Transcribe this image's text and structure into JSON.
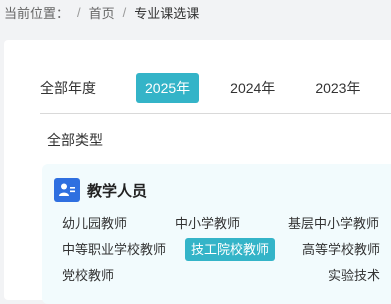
{
  "breadcrumb": {
    "prefix": "当前位置：",
    "sep1": "/",
    "home": "首页",
    "sep2": "/",
    "current": "专业课选课"
  },
  "year_filter": {
    "label": "全部年度",
    "items": [
      "2025年",
      "2024年",
      "2023年"
    ],
    "selected": "2025年"
  },
  "type_filter": {
    "label": "全部类型"
  },
  "category": {
    "icon": "teacher-user-icon",
    "title": "教学人员",
    "tags": [
      "幼儿园教师",
      "中小学教师",
      "基层中小学教师",
      "中等职业学校教师",
      "技工院校教师",
      "高等学校教师",
      "党校教师",
      "实验技术"
    ],
    "selected": "技工院校教师"
  },
  "colors": {
    "accent": "#34b4c8",
    "icon_bg": "#2f6fe0",
    "panel_bg": "#f2fbfd"
  }
}
